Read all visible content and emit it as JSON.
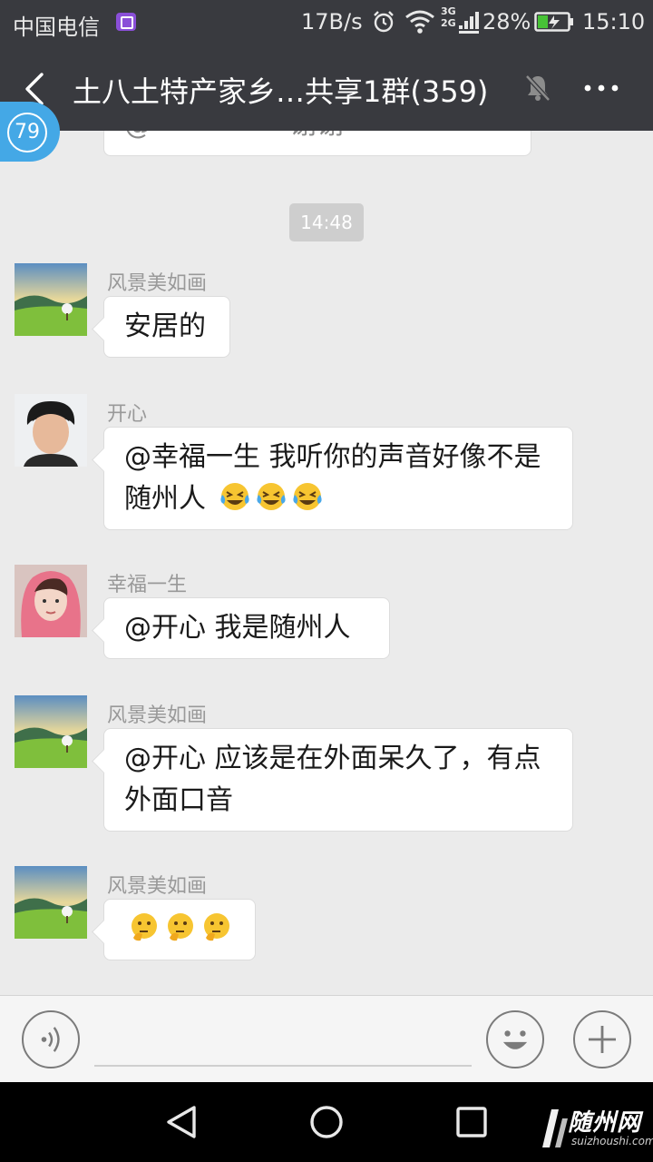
{
  "status_bar": {
    "carrier": "中国电信",
    "net_speed": "17B/s",
    "network_types": [
      "3G",
      "2G"
    ],
    "battery_percent": "28%",
    "time": "15:10"
  },
  "header": {
    "title": "土八土特产家乡…共享1群(359)"
  },
  "unread_badge": "79",
  "chat": {
    "timestamp": "14:48",
    "messages": [
      {
        "sender": "风景美如画",
        "text": "安居的",
        "emoji": []
      },
      {
        "sender": "开心",
        "text": "@幸福一生  我听你的声音好像不是随州人",
        "emoji": [
          "crying-laughing",
          "crying-laughing",
          "crying-laughing"
        ]
      },
      {
        "sender": "幸福一生",
        "text": "@开心  我是随州人",
        "emoji": []
      },
      {
        "sender": "风景美如画",
        "text": "@开心  应该是在外面呆久了，有点外面口音",
        "emoji": []
      },
      {
        "sender": "风景美如画",
        "text": "",
        "emoji": [
          "thinking-face",
          "thinking-face",
          "thinking-face"
        ]
      }
    ]
  },
  "input_bar": {
    "icons": [
      "voice-icon",
      "emoji-icon",
      "plus-icon"
    ]
  },
  "nav_bar": {
    "icons": [
      "back-triangle-icon",
      "home-circle-icon",
      "recents-square-icon"
    ]
  },
  "watermark": {
    "title": "随州网",
    "url": "suizhoushi.com"
  },
  "colors": {
    "header_bg": "#393a3f",
    "chat_bg": "#ebebeb",
    "bubble_bg": "#ffffff",
    "badge_blue": "#44a8e6",
    "sender_gray": "#999999"
  }
}
